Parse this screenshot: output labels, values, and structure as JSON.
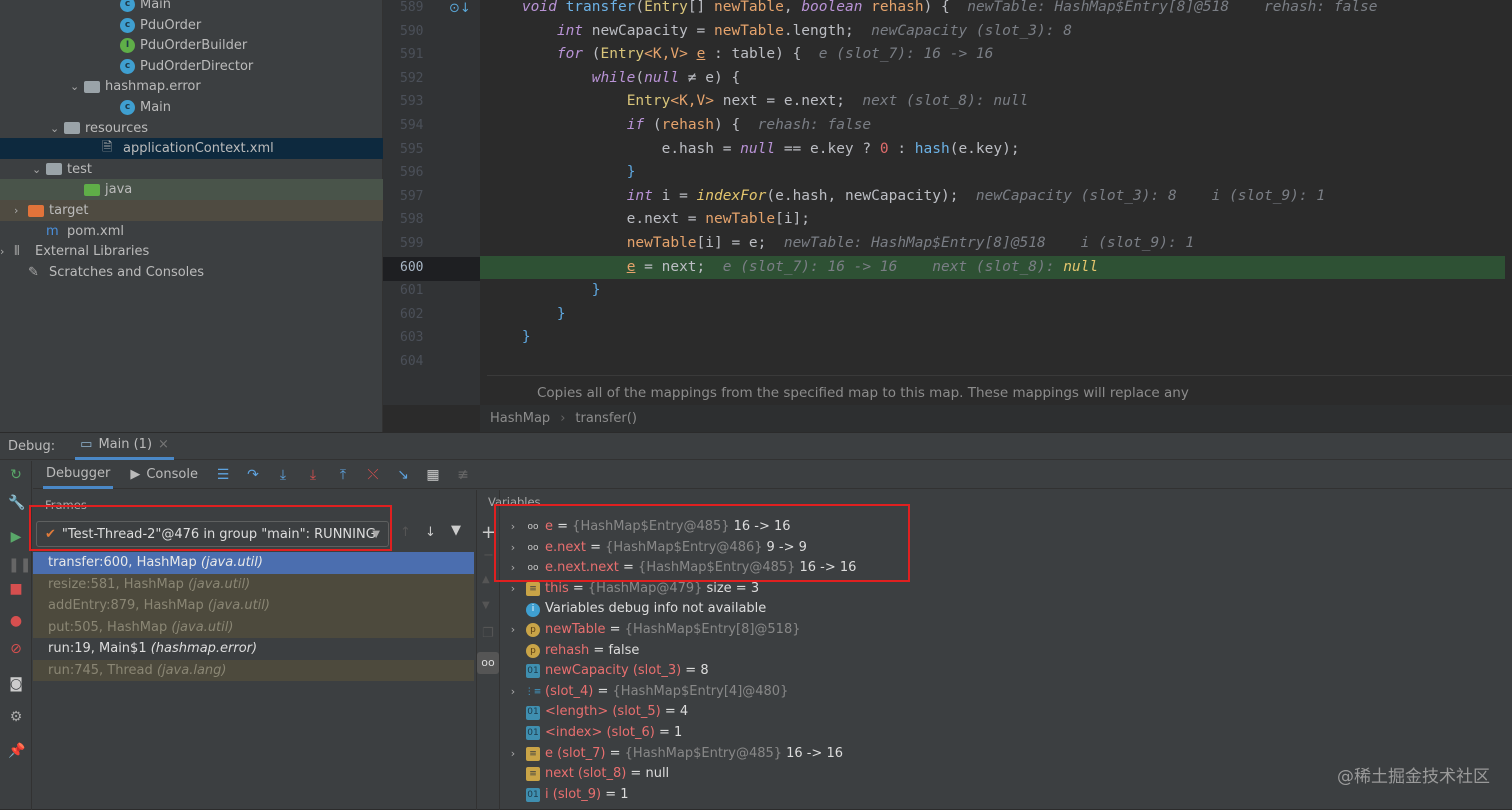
{
  "tree": [
    {
      "label": "Main",
      "icon": "class",
      "indent": 120
    },
    {
      "label": "PduOrder",
      "icon": "class",
      "indent": 120
    },
    {
      "label": "PduOrderBuilder",
      "icon": "interface",
      "indent": 120
    },
    {
      "label": "PudOrderDirector",
      "icon": "class",
      "indent": 120
    },
    {
      "label": "hashmap.error",
      "icon": "package",
      "indent": 84,
      "expanded": true
    },
    {
      "label": "Main",
      "icon": "main-class",
      "indent": 120
    },
    {
      "label": "resources",
      "icon": "resources-folder",
      "indent": 64,
      "expanded": true
    },
    {
      "label": "applicationContext.xml",
      "icon": "xml",
      "indent": 102,
      "selected": true
    },
    {
      "label": "test",
      "icon": "folder",
      "indent": 46,
      "expanded": true
    },
    {
      "label": "java",
      "icon": "test-folder",
      "indent": 84,
      "bg": "green"
    },
    {
      "label": "target",
      "icon": "excluded-folder",
      "indent": 28,
      "collapsed": true,
      "bg": "orange"
    },
    {
      "label": "pom.xml",
      "icon": "maven",
      "indent": 46
    },
    {
      "label": "External Libraries",
      "icon": "libraries",
      "indent": 10,
      "collapsed": true
    },
    {
      "label": "Scratches and Consoles",
      "icon": "scratches",
      "indent": 28
    }
  ],
  "editor": {
    "line_numbers": [
      "589",
      "590",
      "591",
      "592",
      "593",
      "594",
      "595",
      "596",
      "597",
      "598",
      "599",
      "600",
      "601",
      "602",
      "603",
      "604"
    ],
    "current_line": "600",
    "lines": [
      [
        [
          "",
          "    "
        ],
        [
          "kw",
          "void"
        ],
        [
          "",
          " "
        ],
        [
          "fn",
          "transfer"
        ],
        [
          "",
          "("
        ],
        [
          "ty",
          "Entry"
        ],
        [
          "",
          "[] "
        ],
        [
          "pa",
          "newTable"
        ],
        [
          "",
          ", "
        ],
        [
          "kw",
          "boolean"
        ],
        [
          "",
          " "
        ],
        [
          "pa",
          "rehash"
        ],
        [
          "",
          ") {  "
        ],
        [
          "hint",
          "newTable: HashMap$Entry[8]@518    rehash: false"
        ]
      ],
      [
        [
          "",
          "        "
        ],
        [
          "kw",
          "int"
        ],
        [
          "",
          " newCapacity = "
        ],
        [
          "pa",
          "newTable"
        ],
        [
          "",
          ".length;  "
        ],
        [
          "hint",
          "newCapacity (slot_3): 8"
        ]
      ],
      [
        [
          "",
          "        "
        ],
        [
          "kw",
          "for"
        ],
        [
          "",
          " ("
        ],
        [
          "ty",
          "Entry"
        ],
        [
          "pa",
          "<K,V>"
        ],
        [
          "",
          " "
        ],
        [
          "ul",
          "e"
        ],
        [
          "",
          " : table) {  "
        ],
        [
          "hint",
          "e (slot_7): 16 -> 16"
        ]
      ],
      [
        [
          "",
          "            "
        ],
        [
          "kw",
          "while"
        ],
        [
          "",
          "("
        ],
        [
          "kw",
          "null"
        ],
        [
          "",
          " ≠ e) {"
        ]
      ],
      [
        [
          "",
          "                "
        ],
        [
          "ty",
          "Entry"
        ],
        [
          "pa",
          "<K,V>"
        ],
        [
          "",
          " next = e.next;  "
        ],
        [
          "hint",
          "next (slot_8): null"
        ]
      ],
      [
        [
          "",
          "                "
        ],
        [
          "kw",
          "if"
        ],
        [
          "",
          " ("
        ],
        [
          "pa",
          "rehash"
        ],
        [
          "",
          ") {  "
        ],
        [
          "hint",
          "rehash: false"
        ]
      ],
      [
        [
          "",
          "                    e.hash = "
        ],
        [
          "kw",
          "null"
        ],
        [
          "",
          " == e.key ? "
        ],
        [
          "num",
          "0"
        ],
        [
          "",
          " : "
        ],
        [
          "fn",
          "hash"
        ],
        [
          "",
          "(e.key);"
        ]
      ],
      [
        [
          "",
          "                "
        ],
        [
          "br",
          "}"
        ]
      ],
      [
        [
          "",
          "                "
        ],
        [
          "kw",
          "int"
        ],
        [
          "",
          " i = "
        ],
        [
          "it",
          "indexFor"
        ],
        [
          "",
          "(e.hash, newCapacity);  "
        ],
        [
          "hint",
          "newCapacity (slot_3): 8    i (slot_9): 1"
        ]
      ],
      [
        [
          "",
          "                e.next = "
        ],
        [
          "pa",
          "newTable"
        ],
        [
          "",
          "[i];"
        ]
      ],
      [
        [
          "",
          "                "
        ],
        [
          "pa",
          "newTable"
        ],
        [
          "",
          "[i] = e;  "
        ],
        [
          "hint",
          "newTable: HashMap$Entry[8]@518    i (slot_9): 1"
        ]
      ],
      [
        [
          "",
          "                "
        ],
        [
          "ul",
          "e"
        ],
        [
          "",
          " = next;  "
        ],
        [
          "hint",
          "e (slot_7): 16 -> 16    next (slot_8): "
        ],
        [
          "it",
          "null"
        ]
      ],
      [
        [
          "",
          "            "
        ],
        [
          "br",
          "}"
        ]
      ],
      [
        [
          "",
          "        "
        ],
        [
          "br",
          "}"
        ]
      ],
      [
        [
          "",
          "    "
        ],
        [
          "br",
          "}"
        ]
      ],
      [
        [
          "",
          ""
        ]
      ]
    ],
    "doc_text": "Copies all of the mappings from the specified map to this map. These mappings will replace any",
    "breadcrumb": [
      "HashMap",
      "transfer()"
    ]
  },
  "debug": {
    "label": "Debug:",
    "session_tab": "Main (1)",
    "tabs": [
      "Debugger",
      "Console"
    ],
    "frames_label": "Frames",
    "thread": "\"Test-Thread-2\"@476 in group \"main\": RUNNING",
    "frames": [
      {
        "method": "transfer:600, HashMap",
        "pkg": "(java.util)",
        "state": "selected"
      },
      {
        "method": "resize:581, HashMap",
        "pkg": "(java.util)",
        "state": "library"
      },
      {
        "method": "addEntry:879, HashMap",
        "pkg": "(java.util)",
        "state": "library"
      },
      {
        "method": "put:505, HashMap",
        "pkg": "(java.util)",
        "state": "library"
      },
      {
        "method": "run:19, Main$1",
        "pkg": "(hashmap.error)",
        "state": "user"
      },
      {
        "method": "run:745, Thread",
        "pkg": "(java.lang)",
        "state": "library"
      }
    ],
    "variables_label": "Variables",
    "variables": [
      {
        "icon": "watch",
        "name": "e",
        "ref": "{HashMap$Entry@485}",
        "value": "16 -> 16",
        "expandable": true
      },
      {
        "icon": "watch",
        "name": "e.next",
        "ref": "{HashMap$Entry@486}",
        "value": "9 -> 9",
        "expandable": true
      },
      {
        "icon": "watch",
        "name": "e.next.next",
        "ref": "{HashMap$Entry@485}",
        "value": "16 -> 16",
        "expandable": true
      },
      {
        "icon": "field",
        "name": "this",
        "ref": "{HashMap@479}",
        "value": " size = 3",
        "expandable": true
      },
      {
        "icon": "info",
        "name": "",
        "ref": "",
        "value": "Variables debug info not available",
        "expandable": false
      },
      {
        "icon": "param",
        "name": "newTable",
        "ref": "{HashMap$Entry[8]@518}",
        "value": "",
        "expandable": true
      },
      {
        "icon": "param",
        "name": "rehash",
        "ref": "",
        "value": "false",
        "expandable": false
      },
      {
        "icon": "primitive",
        "name": "newCapacity (slot_3)",
        "ref": "",
        "value": "8",
        "expandable": false
      },
      {
        "icon": "array",
        "name": " (slot_4)",
        "ref": "{HashMap$Entry[4]@480}",
        "value": "",
        "expandable": true
      },
      {
        "icon": "primitive",
        "name": "<length> (slot_5)",
        "ref": "",
        "value": "4",
        "expandable": false
      },
      {
        "icon": "primitive",
        "name": "<index> (slot_6)",
        "ref": "",
        "value": "1",
        "expandable": false
      },
      {
        "icon": "field",
        "name": "e (slot_7)",
        "ref": "{HashMap$Entry@485}",
        "value": "16 -> 16",
        "expandable": true
      },
      {
        "icon": "field",
        "name": "next (slot_8)",
        "ref": "",
        "value": "null",
        "expandable": false
      },
      {
        "icon": "primitive",
        "name": "i (slot_9)",
        "ref": "",
        "value": "1",
        "expandable": false
      }
    ]
  },
  "watermark": "@稀土掘金技术社区",
  "colors": {
    "highlight": "#2e5134",
    "selection": "#4b6eaf",
    "annotation_box": "#e02020"
  }
}
